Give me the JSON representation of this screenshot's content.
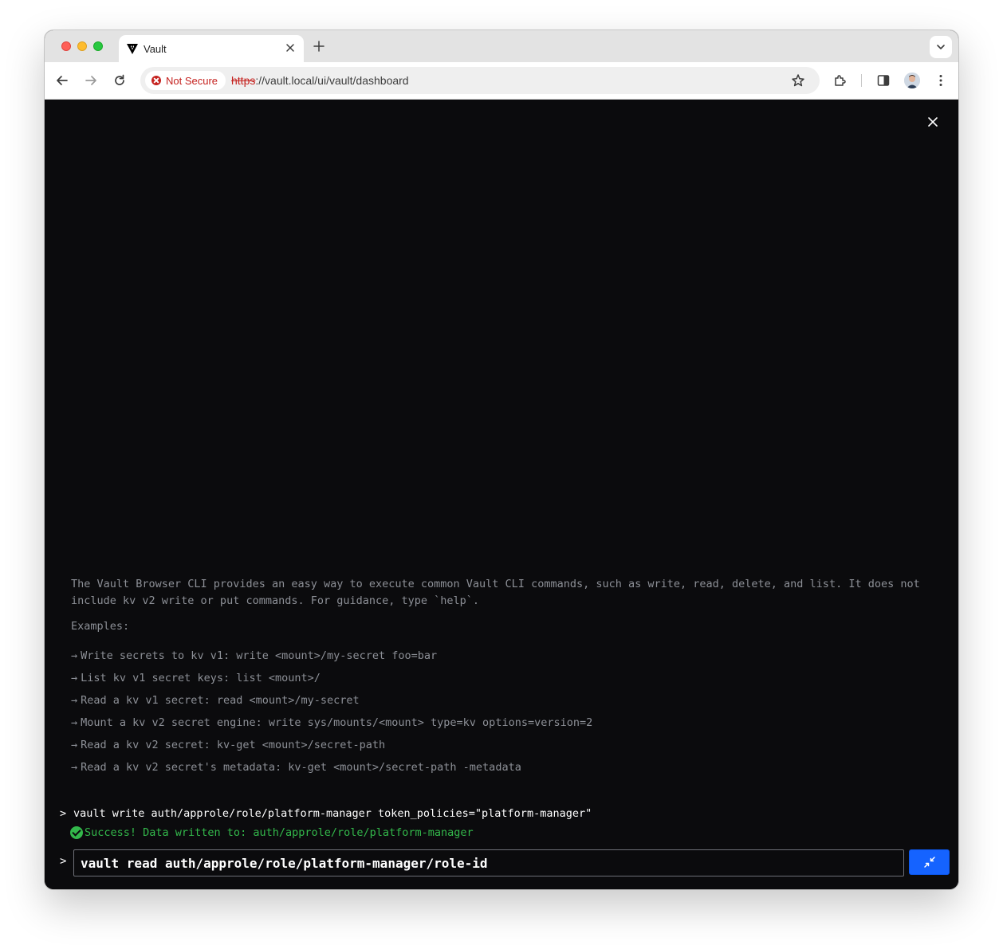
{
  "browser": {
    "tab_title": "Vault",
    "security_chip": "Not Secure",
    "url_scheme": "https",
    "url_rest": "://vault.local/ui/vault/dashboard"
  },
  "console": {
    "intro": "The Vault Browser CLI provides an easy way to execute common Vault CLI commands, such as write, read, delete, and list. It does not include kv v2 write or put commands. For guidance, type `help`.",
    "examples_title": "Examples:",
    "examples": [
      "Write secrets to kv v1: write <mount>/my-secret foo=bar",
      "List kv v1 secret keys: list <mount>/",
      "Read a kv v1 secret: read <mount>/my-secret",
      "Mount a kv v2 secret engine: write sys/mounts/<mount> type=kv options=version=2",
      "Read a kv v2 secret: kv-get <mount>/secret-path",
      "Read a kv v2 secret's metadata: kv-get <mount>/secret-path -metadata"
    ],
    "history": {
      "command": "vault write auth/approle/role/platform-manager token_policies=\"platform-manager\"",
      "result": "Success! Data written to: auth/approle/role/platform-manager"
    },
    "input_value": "vault read auth/approle/role/platform-manager/role-id"
  },
  "colors": {
    "console_bg": "#0b0b0d",
    "success": "#33b84b",
    "accent": "#1563ff",
    "muted_text": "#8d9097",
    "not_secure": "#c5221f"
  },
  "icons": {
    "tab": "vault-triangle-icon",
    "close": "close-icon",
    "minimize": "minimize-icon"
  }
}
